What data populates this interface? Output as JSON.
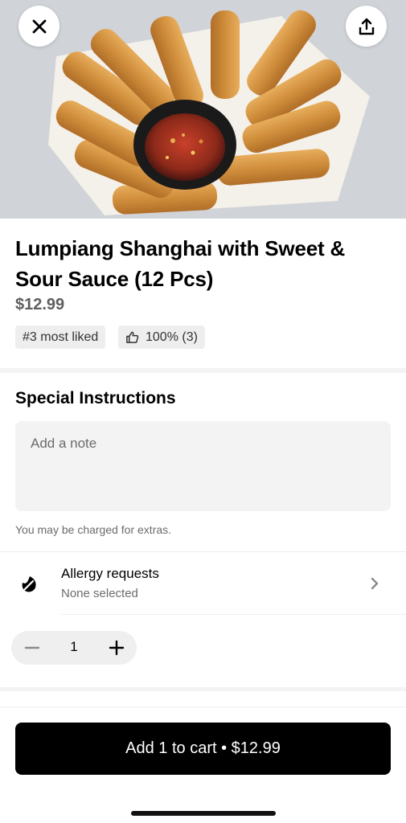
{
  "item": {
    "title": "Lumpiang Shanghai with Sweet & Sour Sauce (12 Pcs)",
    "price": "$12.99",
    "rank_badge": "#3 most liked",
    "like_badge": "100% (3)"
  },
  "special_instructions": {
    "title": "Special Instructions",
    "note_placeholder": "Add a note",
    "extras_notice": "You may be charged for extras."
  },
  "allergy": {
    "label": "Allergy requests",
    "value": "None selected"
  },
  "quantity": {
    "value": "1"
  },
  "cart": {
    "button_label": "Add 1 to cart • $12.99"
  },
  "icons": {
    "close": "close-icon",
    "share": "share-icon",
    "like": "thumbs-up-icon",
    "allergy": "allergy-icon",
    "chevron": "chevron-right-icon",
    "minus": "minus-icon",
    "plus": "plus-icon"
  },
  "colors": {
    "primary_button": "#000000",
    "muted_text": "#6b6b6b",
    "chip_background": "#eeeeee"
  }
}
